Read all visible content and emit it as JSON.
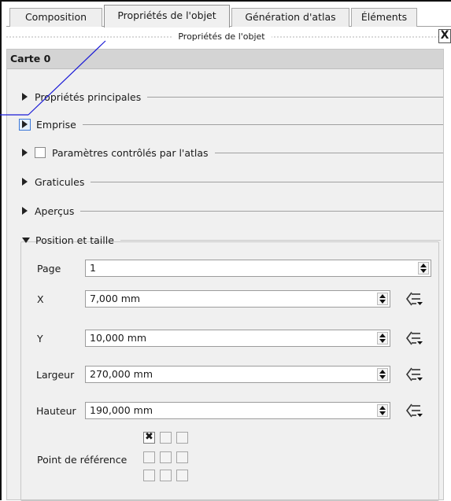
{
  "tabs": [
    {
      "label": "Composition"
    },
    {
      "label": "Propriétés de l'objet"
    },
    {
      "label": "Génération d'atlas"
    },
    {
      "label": "Éléments"
    }
  ],
  "dock": {
    "title": "Propriétés de l'objet",
    "close_label": "X"
  },
  "panel": {
    "header": "Carte 0"
  },
  "sections": [
    {
      "label": "Propriétés principales",
      "state": "collapsed"
    },
    {
      "label": "Emprise",
      "state": "collapsed-highlighted"
    },
    {
      "label": "Paramètres contrôlés par l'atlas",
      "state": "collapsed",
      "checkbox": false
    },
    {
      "label": "Graticules",
      "state": "collapsed"
    },
    {
      "label": "Aperçus",
      "state": "collapsed"
    },
    {
      "label": "Position et taille",
      "state": "expanded"
    }
  ],
  "fields": {
    "page": {
      "label": "Page",
      "value": "1"
    },
    "x": {
      "label": "X",
      "value": "7,000 mm"
    },
    "y": {
      "label": "Y",
      "value": "10,000 mm"
    },
    "width": {
      "label": "Largeur",
      "value": "270,000 mm"
    },
    "height": {
      "label": "Hauteur",
      "value": "190,000 mm"
    },
    "reference_point": {
      "label": "Point de référence",
      "selected_cell": "top-left",
      "check_glyph": "✖"
    }
  },
  "icons": {
    "data_defined": "data-defined-override-icon",
    "expand": "triangle-right-icon",
    "collapse": "triangle-down-icon",
    "spin": "spin-arrows-icon"
  },
  "colors": {
    "panel_bg": "#f0f0f0",
    "header_bg": "#d4d4d4",
    "callout_line": "#1b1bd6",
    "highlight_border": "#3b78d8"
  }
}
